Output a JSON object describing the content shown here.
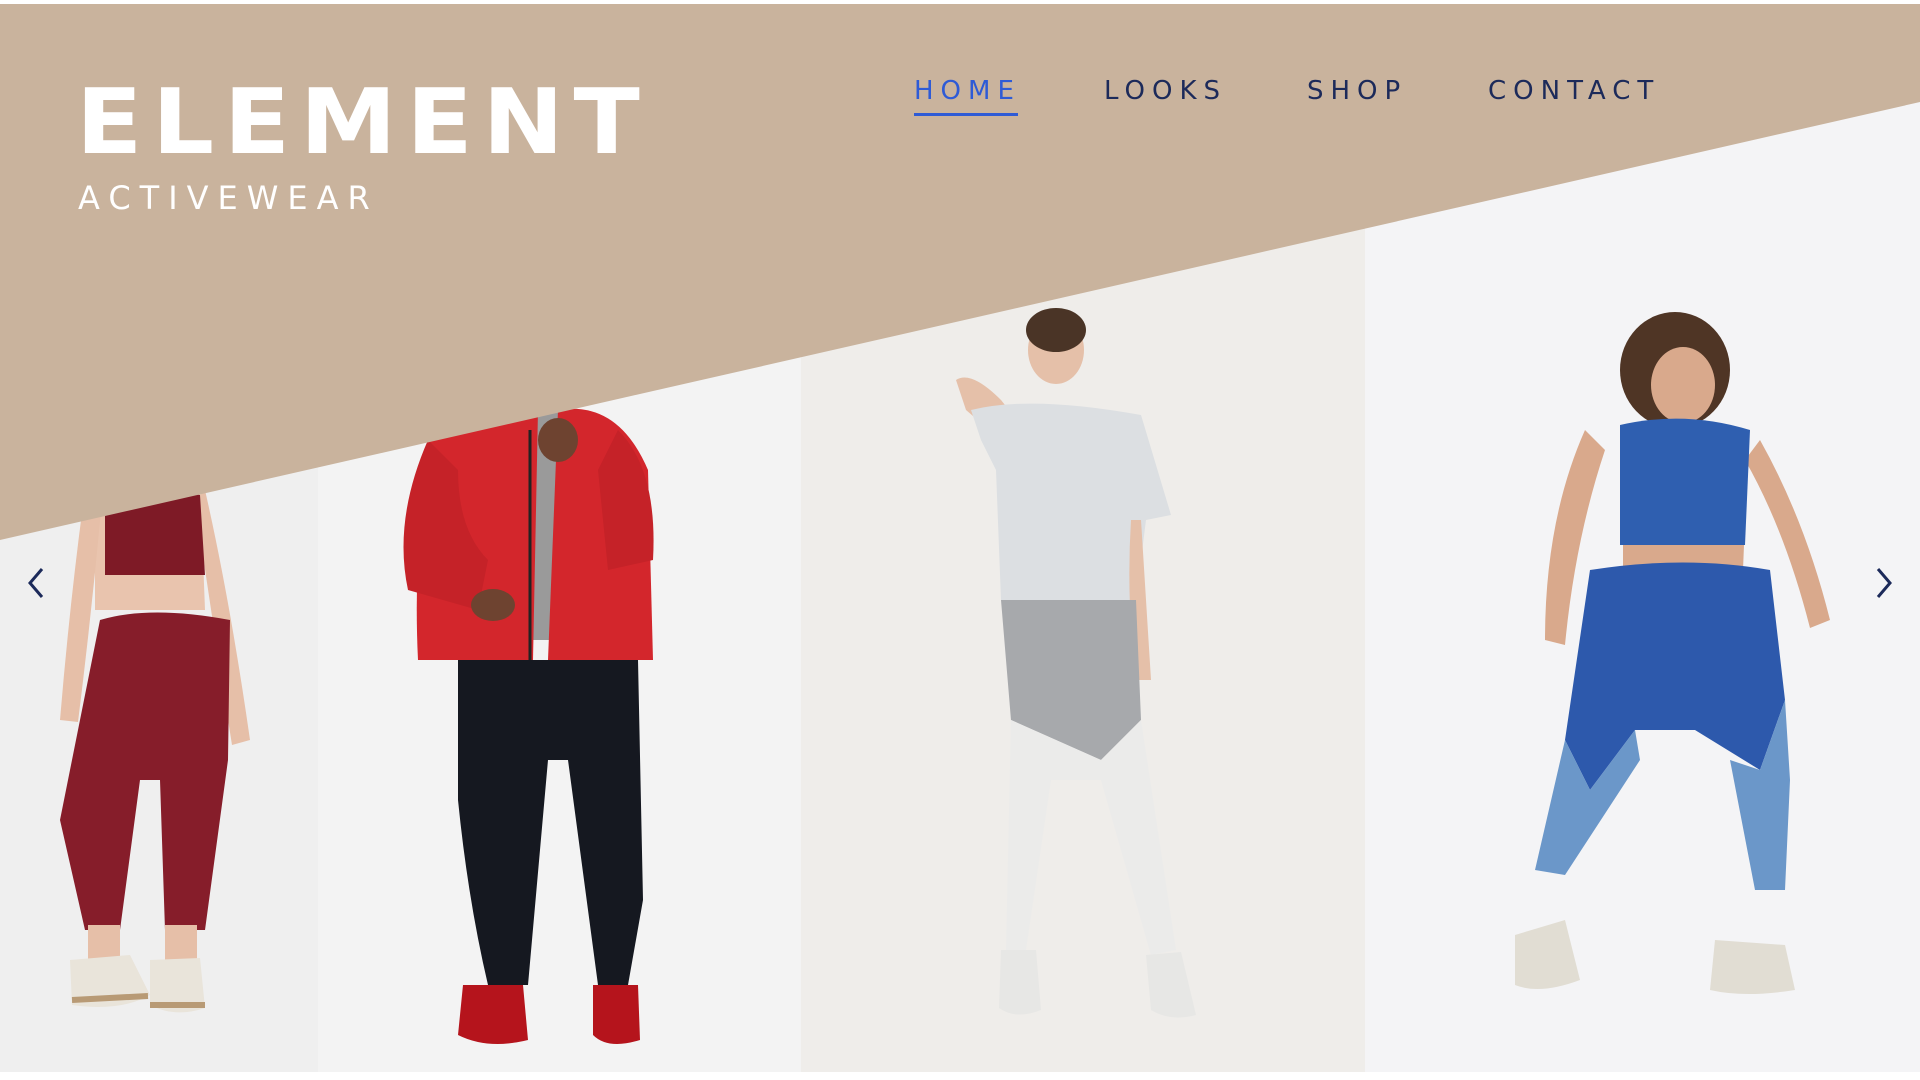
{
  "brand": {
    "name": "ELEMENT",
    "tagline": "ACTIVEWEAR"
  },
  "nav": {
    "items": [
      {
        "label": "HOME",
        "active": true
      },
      {
        "label": "LOOKS",
        "active": false
      },
      {
        "label": "SHOP",
        "active": false
      },
      {
        "label": "CONTACT",
        "active": false
      }
    ]
  },
  "carousel": {
    "prev_icon": "chevron-left-icon",
    "next_icon": "chevron-right-icon",
    "slides": [
      {
        "subject": "woman-burgundy-set"
      },
      {
        "subject": "man-red-jacket"
      },
      {
        "subject": "woman-grey-set"
      },
      {
        "subject": "woman-blue-set"
      }
    ]
  },
  "colors": {
    "header_band": "#c9b39d",
    "nav_text": "#1c2a5a",
    "nav_active": "#2e5bd6",
    "logo": "#ffffff"
  }
}
